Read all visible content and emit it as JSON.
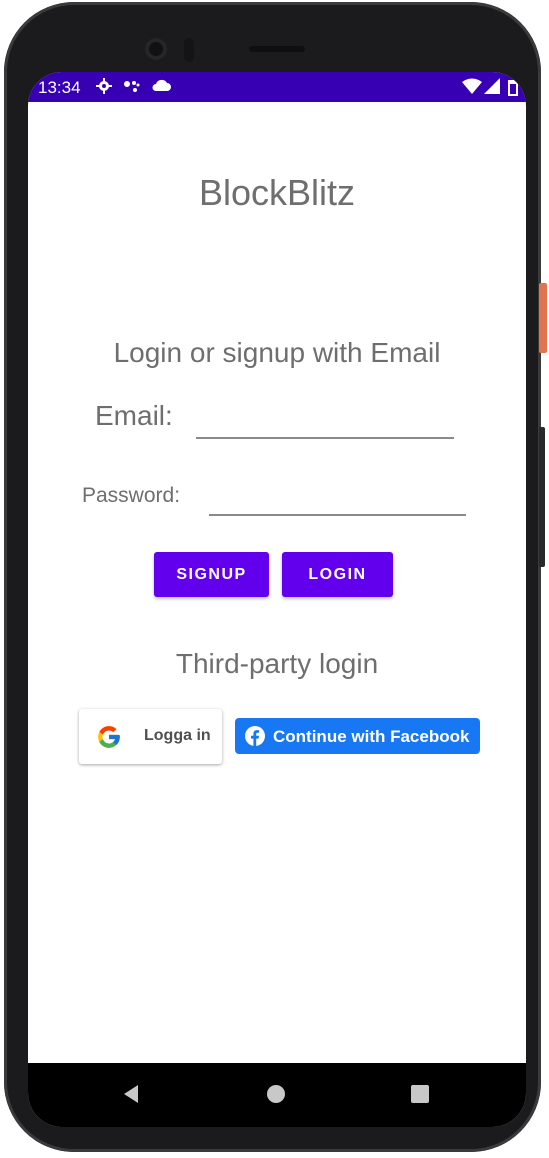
{
  "status_bar": {
    "time": "13:34",
    "icons": [
      "gear-icon",
      "assistant-icon",
      "cloud-icon",
      "wifi-icon",
      "signal-icon",
      "battery-icon"
    ],
    "background": "#3700b3"
  },
  "app": {
    "title": "BlockBlitz"
  },
  "email_section": {
    "heading": "Login or signup with Email",
    "email_label": "Email:",
    "email_value": "",
    "password_label": "Password:",
    "password_value": "",
    "signup_label": "SIGNUP",
    "login_label": "LOGIN",
    "button_color": "#6200ee"
  },
  "third_party": {
    "heading": "Third-party login",
    "google_label": "Logga in",
    "facebook_label": "Continue with Facebook",
    "facebook_color": "#1877f2"
  },
  "nav_bar": {
    "icons": [
      "back-icon",
      "home-icon",
      "recents-icon"
    ]
  }
}
